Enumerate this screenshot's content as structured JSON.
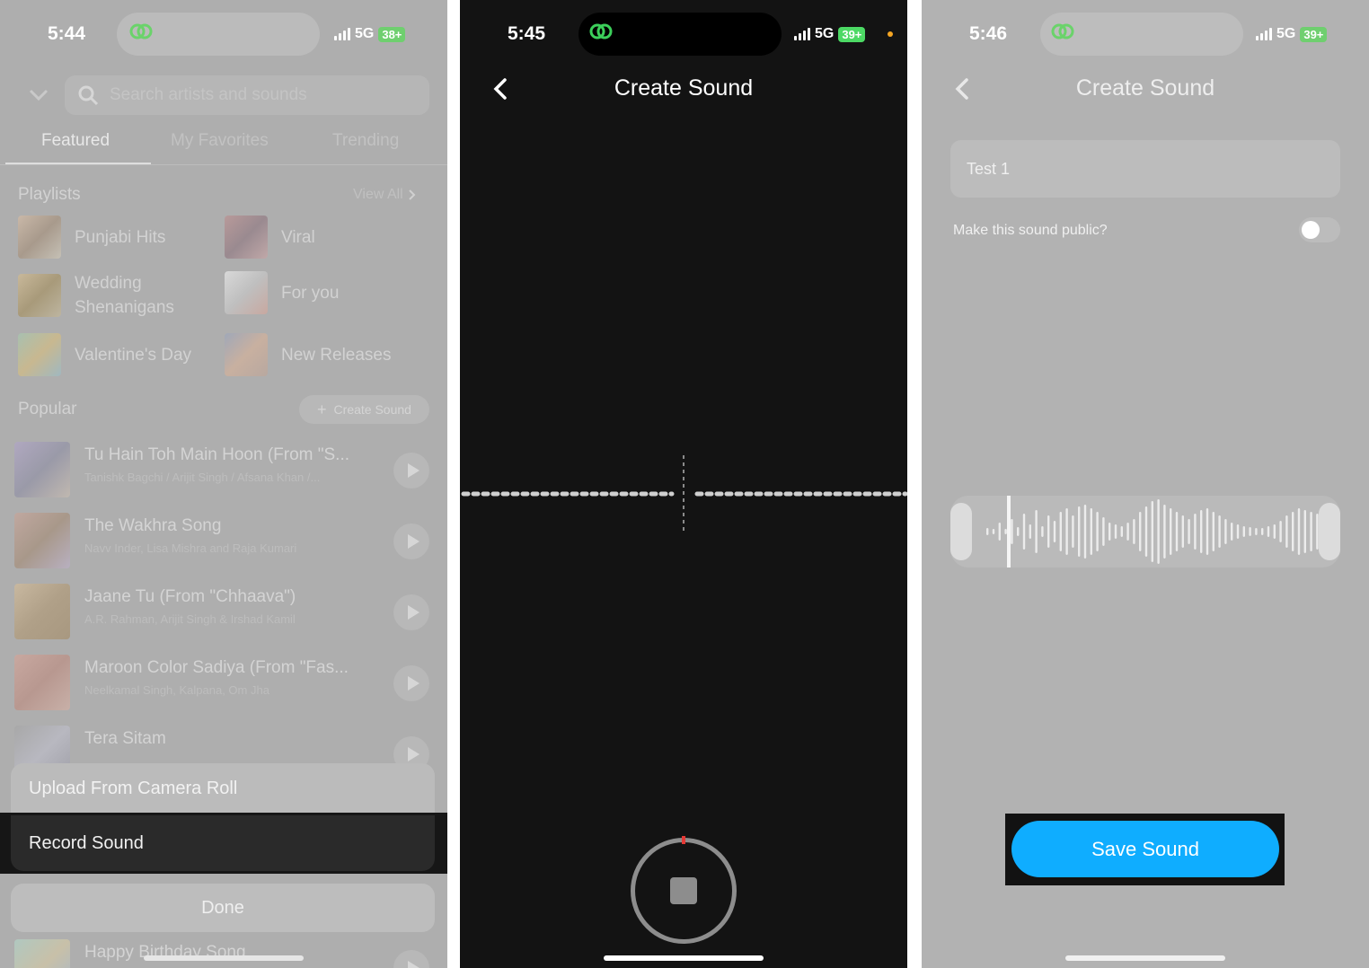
{
  "panel1": {
    "status": {
      "time": "5:44",
      "network": "5G",
      "battery": "38+"
    },
    "search": {
      "placeholder": "Search artists and sounds"
    },
    "tabs": [
      {
        "label": "Featured"
      },
      {
        "label": "My Favorites"
      },
      {
        "label": "Trending"
      }
    ],
    "playlists": {
      "title": "Playlists",
      "view_all": "View All",
      "items": [
        {
          "label": "Punjabi Hits"
        },
        {
          "label": "Viral"
        },
        {
          "label": "Wedding\nShenanigans"
        },
        {
          "label": "For you"
        },
        {
          "label": "Valentine's Day"
        },
        {
          "label": "New Releases"
        }
      ]
    },
    "popular": {
      "title": "Popular",
      "create_button": "Create Sound",
      "songs": [
        {
          "title": "Tu Hain Toh Main Hoon (From \"S...",
          "artist": "Tanishk Bagchi / Arijit Singh / Afsana Khan /..."
        },
        {
          "title": "The Wakhra Song",
          "artist": "Navv Inder, Lisa Mishra and Raja Kumari"
        },
        {
          "title": "Jaane Tu (From \"Chhaava\")",
          "artist": "A.R. Rahman, Arijit Singh & Irshad Kamil"
        },
        {
          "title": "Maroon Color Sadiya (From \"Fas...",
          "artist": "Neelkamal Singh, Kalpana, Om Jha"
        },
        {
          "title": "Tera Sitam",
          "artist": ""
        }
      ],
      "last_song": "Happy Birthday Song"
    },
    "sheet": {
      "upload": "Upload From Camera Roll",
      "record": "Record Sound",
      "done": "Done"
    }
  },
  "panel2": {
    "status": {
      "time": "5:45",
      "network": "5G",
      "battery": "39+"
    },
    "title": "Create Sound"
  },
  "panel3": {
    "status": {
      "time": "5:46",
      "network": "5G",
      "battery": "39+"
    },
    "title": "Create Sound",
    "name_input": {
      "value": "Test 1"
    },
    "public_toggle": {
      "label": "Make this sound public?",
      "on": false
    },
    "save_button": "Save Sound"
  },
  "colors": {
    "accent": "#0fadff",
    "battery": "#4cd964",
    "recording_dot": "#e53935"
  }
}
